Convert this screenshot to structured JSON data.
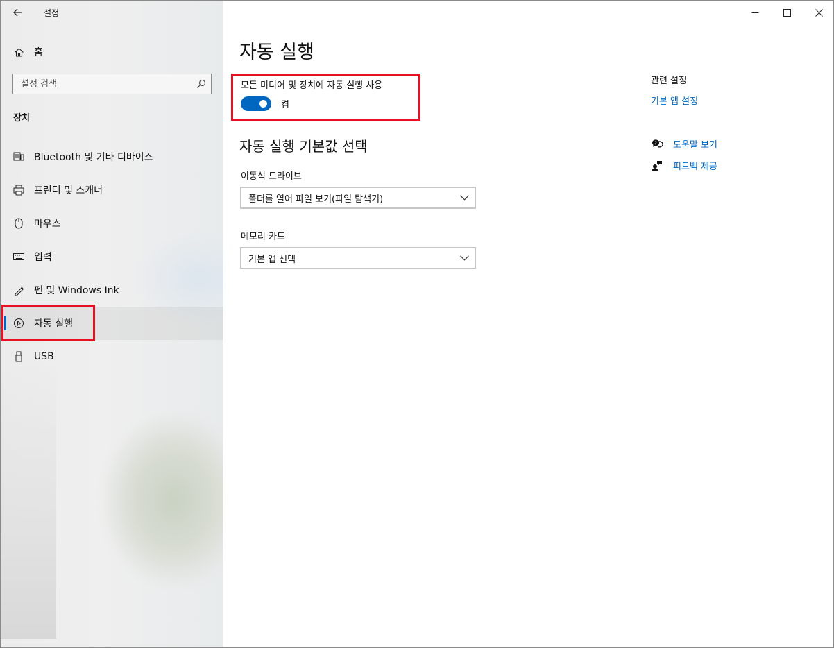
{
  "window": {
    "app_title": "설정",
    "back_icon": "back-arrow-icon"
  },
  "sidebar": {
    "home_label": "홈",
    "search_placeholder": "설정 검색",
    "section_title": "장치",
    "items": [
      {
        "label": "Bluetooth 및 기타 디바이스",
        "icon": "bluetooth-devices-icon"
      },
      {
        "label": "프린터 및 스캐너",
        "icon": "printer-icon"
      },
      {
        "label": "마우스",
        "icon": "mouse-icon"
      },
      {
        "label": "입력",
        "icon": "keyboard-icon"
      },
      {
        "label": "펜 및 Windows Ink",
        "icon": "pen-icon"
      },
      {
        "label": "자동 실행",
        "icon": "autoplay-icon",
        "selected": true
      },
      {
        "label": "USB",
        "icon": "usb-icon"
      }
    ]
  },
  "main": {
    "title": "자동 실행",
    "toggle": {
      "label": "모든 미디어 및 장치에 자동 실행 사용",
      "state_text": "켬",
      "on": true
    },
    "defaults_heading": "자동 실행 기본값 선택",
    "removable_drive": {
      "label": "이동식 드라이브",
      "value": "폴더를 열어 파일 보기(파일 탐색기)"
    },
    "memory_card": {
      "label": "메모리 카드",
      "value": "기본 앱 선택"
    }
  },
  "related": {
    "title": "관련 설정",
    "default_apps_link": "기본 앱 설정",
    "help_link": "도움말 보기",
    "feedback_link": "피드백 제공"
  },
  "colors": {
    "accent": "#0067c0",
    "highlight_box": "#e81123"
  }
}
